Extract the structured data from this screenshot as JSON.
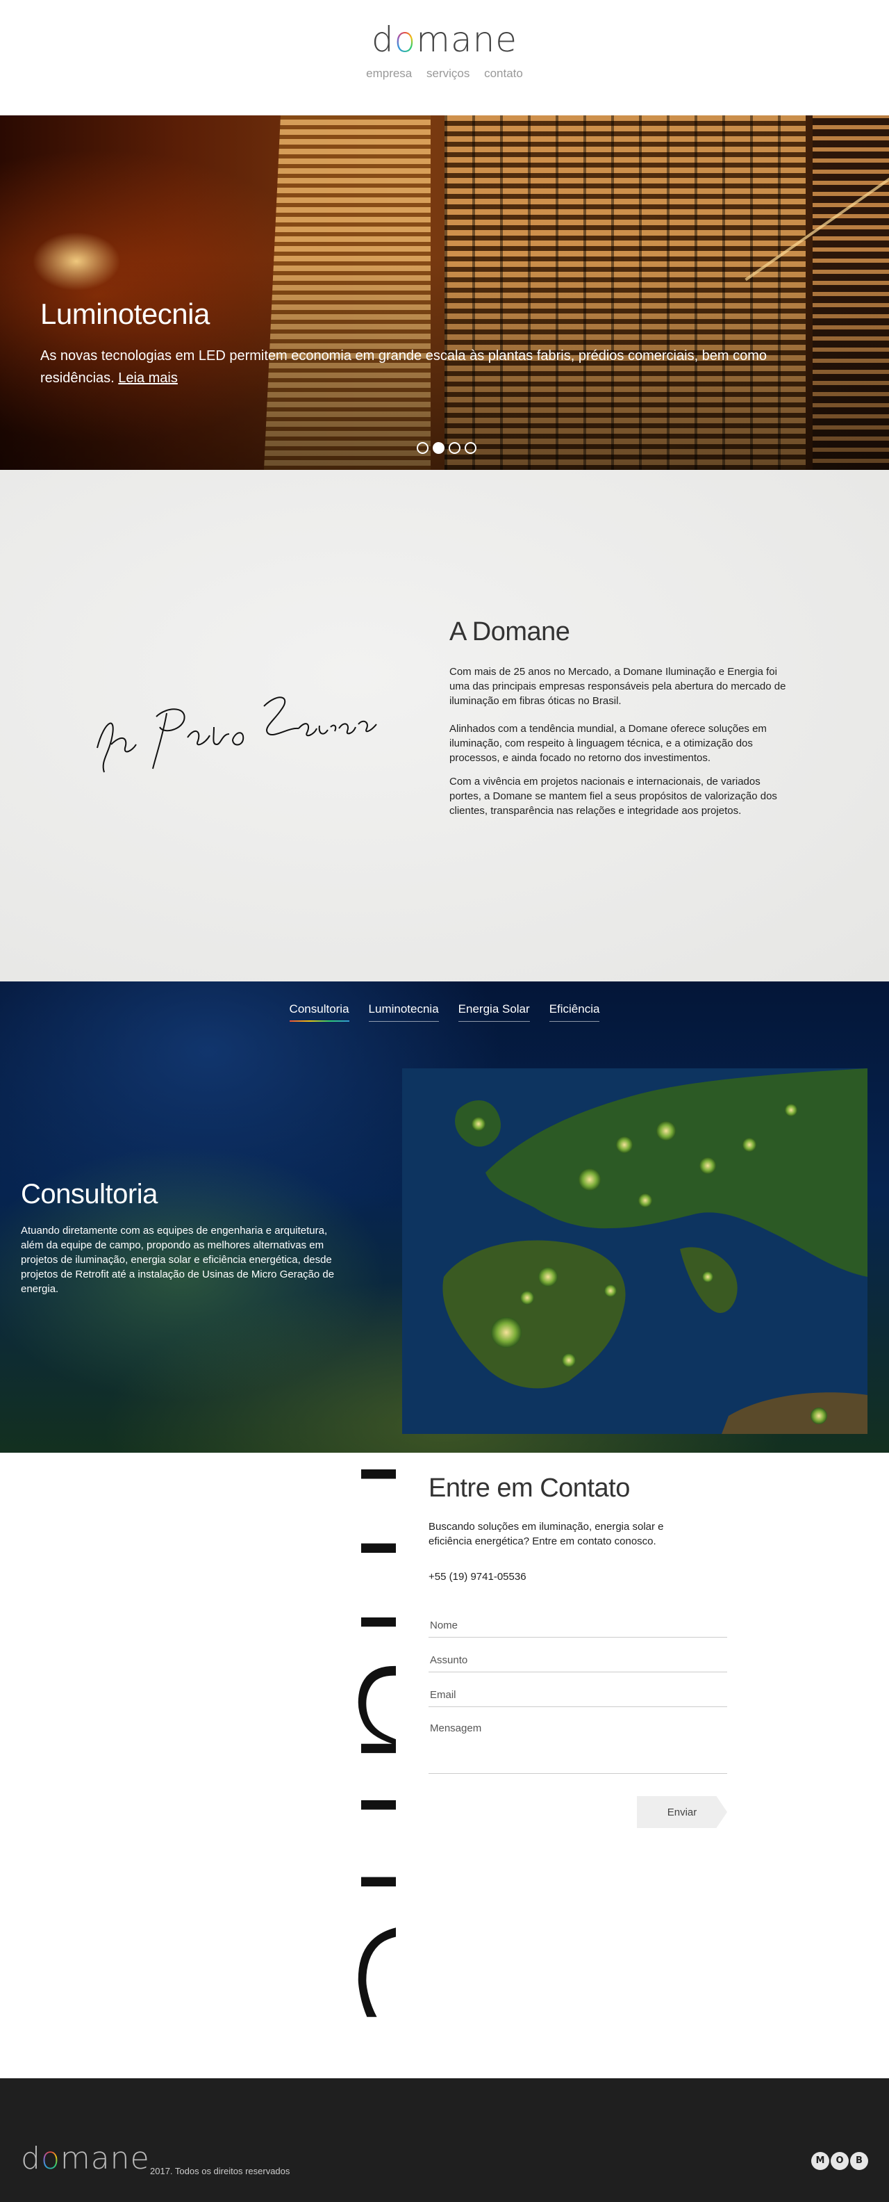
{
  "header": {
    "logo": {
      "d": "d",
      "o": "o",
      "rest": "mane"
    },
    "nav": [
      "empresa",
      "serviços",
      "contato"
    ]
  },
  "hero": {
    "title": "Luminotecnia",
    "text": "As novas tecnologias em LED permitem economia em grande escala às plantas fabris, prédios comerciais, bem como residências.",
    "link": "Leia mais",
    "slides": 4,
    "active_slide": 2
  },
  "about": {
    "signature": "by Pedro Lourenço",
    "title": "A Domane",
    "paragraphs": [
      "Com mais de 25 anos no Mercado, a Domane Iluminação e Energia foi uma das principais empresas responsáveis pela abertura do mercado de iluminação em fibras óticas no Brasil.",
      "Alinhados com a tendência mundial, a Domane oferece soluções em iluminação, com respeito à linguagem técnica, e a otimização dos processos, e ainda focado no retorno dos investimentos.",
      "Com a vivência em projetos nacionais e internacionais, de variados portes, a Domane se mantem fiel a seus propósitos de valorização dos clientes, transparência nas relações e integridade aos projetos."
    ]
  },
  "services": {
    "tabs": [
      "Consultoria",
      "Luminotecnia",
      "Energia Solar",
      "Eficiência"
    ],
    "active_tab": 0,
    "title": "Consultoria",
    "text": "Atuando diretamente com as equipes de engenharia e arquitetura, além da equipe de campo, propondo as melhores alternativas em projetos de iluminação, energia solar e eficiência energética, desde projetos de Retrofit até a instalação de Usinas de Micro Geração de energia."
  },
  "contact": {
    "big_word": "mane",
    "title": "Entre em Contato",
    "description": "Buscando soluções em iluminação, energia solar e eficiência energética? Entre em contato conosco.",
    "phone": "+55 (19) 9741-05536",
    "fields": {
      "name_placeholder": "Nome",
      "subject_placeholder": "Assunto",
      "email_placeholder": "Email",
      "message_placeholder": "Mensagem"
    },
    "send_label": "Enviar"
  },
  "footer": {
    "logo": {
      "d": "d",
      "o": "o",
      "rest": "mane"
    },
    "copyright": "2017. Todos os direitos reservados",
    "badge": [
      "M",
      "O",
      "B"
    ]
  },
  "colors": {
    "accent_gradient": [
      "#e84c3d",
      "#f1c40f",
      "#2ecc71",
      "#3498db"
    ],
    "footer_bg": "#1f1f1f"
  }
}
